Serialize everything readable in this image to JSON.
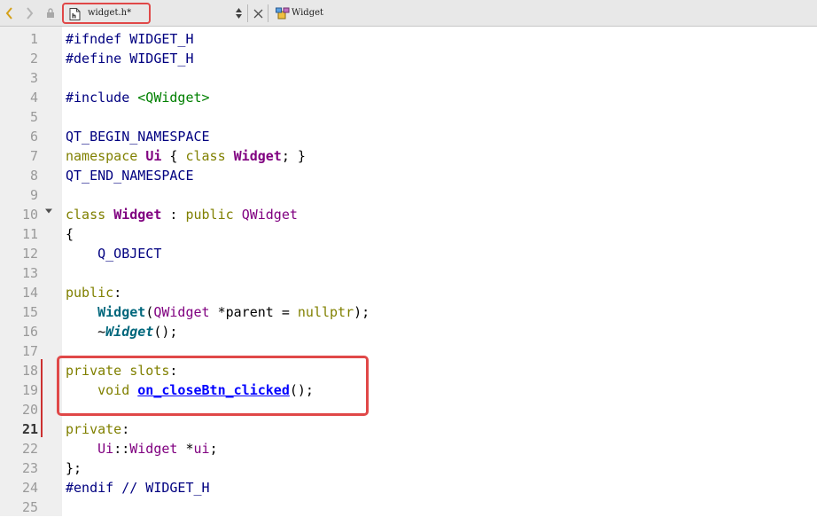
{
  "toolbar": {
    "file_name": "widget.h*",
    "symbol_name": "Widget",
    "icons": [
      "chevron-left-icon",
      "chevron-right-icon",
      "lock-icon",
      "header-file-icon",
      "updown-arrows-icon",
      "close-icon",
      "class-symbol-icon"
    ]
  },
  "editor": {
    "current_line": 21,
    "line_numbers": [
      "1",
      "2",
      "3",
      "4",
      "5",
      "6",
      "7",
      "8",
      "9",
      "10",
      "11",
      "12",
      "13",
      "14",
      "15",
      "16",
      "17",
      "18",
      "19",
      "20",
      "21",
      "22",
      "23",
      "24",
      "25"
    ],
    "lines": [
      [
        {
          "t": "#ifndef WIDGET_H",
          "c": "pp"
        }
      ],
      [
        {
          "t": "#define WIDGET_H",
          "c": "pp"
        }
      ],
      [],
      [
        {
          "t": "#include ",
          "c": "pp"
        },
        {
          "t": "<QWidget>",
          "c": "str"
        }
      ],
      [],
      [
        {
          "t": "QT_BEGIN_NAMESPACE",
          "c": "mac"
        }
      ],
      [
        {
          "t": "namespace",
          "c": "kw"
        },
        {
          "t": " ",
          "c": ""
        },
        {
          "t": "Ui",
          "c": "cls"
        },
        {
          "t": " { ",
          "c": ""
        },
        {
          "t": "class",
          "c": "kw"
        },
        {
          "t": " ",
          "c": ""
        },
        {
          "t": "Widget",
          "c": "cls"
        },
        {
          "t": "; }",
          "c": ""
        }
      ],
      [
        {
          "t": "QT_END_NAMESPACE",
          "c": "mac"
        }
      ],
      [],
      [
        {
          "t": "class",
          "c": "kw"
        },
        {
          "t": " ",
          "c": ""
        },
        {
          "t": "Widget",
          "c": "cls"
        },
        {
          "t": " : ",
          "c": ""
        },
        {
          "t": "public",
          "c": "kw"
        },
        {
          "t": " ",
          "c": ""
        },
        {
          "t": "QWidget",
          "c": "type"
        }
      ],
      [
        {
          "t": "{",
          "c": ""
        }
      ],
      [
        {
          "t": "    Q_OBJECT",
          "c": "mac"
        }
      ],
      [],
      [
        {
          "t": "public",
          "c": "kw"
        },
        {
          "t": ":",
          "c": ""
        }
      ],
      [
        {
          "t": "    ",
          "c": ""
        },
        {
          "t": "Widget",
          "c": "fn"
        },
        {
          "t": "(",
          "c": ""
        },
        {
          "t": "QWidget",
          "c": "type"
        },
        {
          "t": " *parent = ",
          "c": ""
        },
        {
          "t": "nullptr",
          "c": "kw"
        },
        {
          "t": ");",
          "c": ""
        }
      ],
      [
        {
          "t": "    ~",
          "c": ""
        },
        {
          "t": "Widget",
          "c": "fni"
        },
        {
          "t": "();",
          "c": ""
        }
      ],
      [],
      [
        {
          "t": "private",
          "c": "kw"
        },
        {
          "t": " ",
          "c": ""
        },
        {
          "t": "slots",
          "c": "kw"
        },
        {
          "t": ":",
          "c": ""
        }
      ],
      [
        {
          "t": "    ",
          "c": ""
        },
        {
          "t": "void",
          "c": "kw"
        },
        {
          "t": " ",
          "c": ""
        },
        {
          "t": "on_closeBtn_clicked",
          "c": "link"
        },
        {
          "t": "();",
          "c": ""
        }
      ],
      [],
      [
        {
          "t": "private",
          "c": "kw"
        },
        {
          "t": ":",
          "c": ""
        }
      ],
      [
        {
          "t": "    ",
          "c": ""
        },
        {
          "t": "Ui",
          "c": "type"
        },
        {
          "t": "::",
          "c": ""
        },
        {
          "t": "Widget",
          "c": "type"
        },
        {
          "t": " *",
          "c": ""
        },
        {
          "t": "ui",
          "c": "type"
        },
        {
          "t": ";",
          "c": ""
        }
      ],
      [
        {
          "t": "};",
          "c": ""
        }
      ],
      [
        {
          "t": "#endif // WIDGET_H",
          "c": "pp"
        }
      ],
      []
    ]
  },
  "colors": {
    "highlight_border": "#e04848",
    "keyword": "#808000",
    "class_name": "#800080",
    "function": "#00677c",
    "preprocessor": "#000080",
    "string": "#008000",
    "link": "#0000ff"
  }
}
